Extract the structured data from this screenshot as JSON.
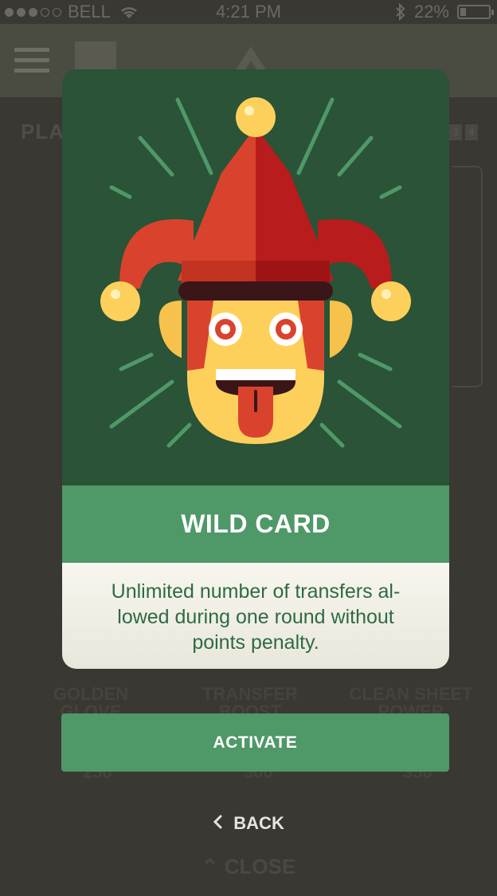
{
  "status_bar": {
    "carrier": "BELL",
    "time": "4:21 PM",
    "battery": "22%",
    "battery_level": 0.22
  },
  "background": {
    "section_label": "PLA",
    "pages": [
      "3",
      "4"
    ],
    "items": [
      {
        "label": "GOLDEN GLOVE",
        "cost": "250"
      },
      {
        "label": "TRANSFER BOOST",
        "cost": "300"
      },
      {
        "label": "CLEAN SHEET POWER",
        "cost": "350"
      }
    ],
    "close_label": "CLOSE"
  },
  "modal": {
    "title": "WILD CARD",
    "description": "Unlimited number of transfers al-lowed during one round without points penalty.",
    "activate_label": "ACTIVATE",
    "back_label": "BACK"
  },
  "colors": {
    "card_dark_green": "#2a5337",
    "accent_green": "#4f9868",
    "jester_red": "#d9432d",
    "jester_yellow": "#fdd05c"
  }
}
